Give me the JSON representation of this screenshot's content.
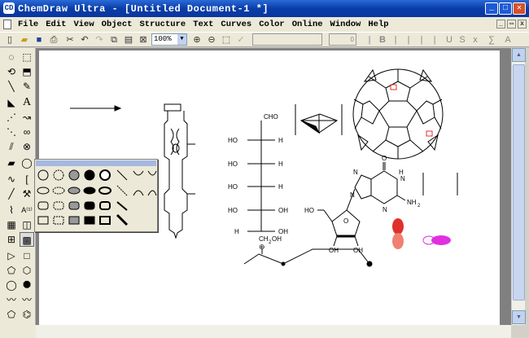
{
  "window": {
    "title": "ChemDraw Ultra - [Untitled Document-1 *]",
    "app_icon": "CD",
    "minimize": "_",
    "maximize": "□",
    "close": "✕"
  },
  "menu": {
    "items": [
      "File",
      "Edit",
      "View",
      "Object",
      "Structure",
      "Text",
      "Curves",
      "Color",
      "Online",
      "Window",
      "Help"
    ]
  },
  "toolbar": {
    "zoom_value": "100%",
    "field1": "",
    "field2": "0"
  },
  "canvas": {
    "aldehyde": "CHO",
    "hexose_left": [
      "HO",
      "HO",
      "HO",
      "HO",
      "H"
    ],
    "hexose_right": [
      "H",
      "H",
      "H",
      "OH",
      "OH"
    ],
    "hexose_bottom": "CH",
    "hexose_sub": "2",
    "hexose_bottom_oh": "OH",
    "purine_o": "O",
    "purine_n": [
      "N",
      "N",
      "N",
      "N"
    ],
    "purine_h": "H",
    "amine": "NH",
    "amine_sub": "2",
    "sugar_ho": "HO",
    "sugar_o": "O",
    "sugar_oh": [
      "OH",
      "OH"
    ],
    "plus_charge": "⊕"
  },
  "colors": {
    "title_bar": "#0a3ea8",
    "orbital_red": "#e0302b",
    "orbital_magenta": "#e030e0"
  }
}
